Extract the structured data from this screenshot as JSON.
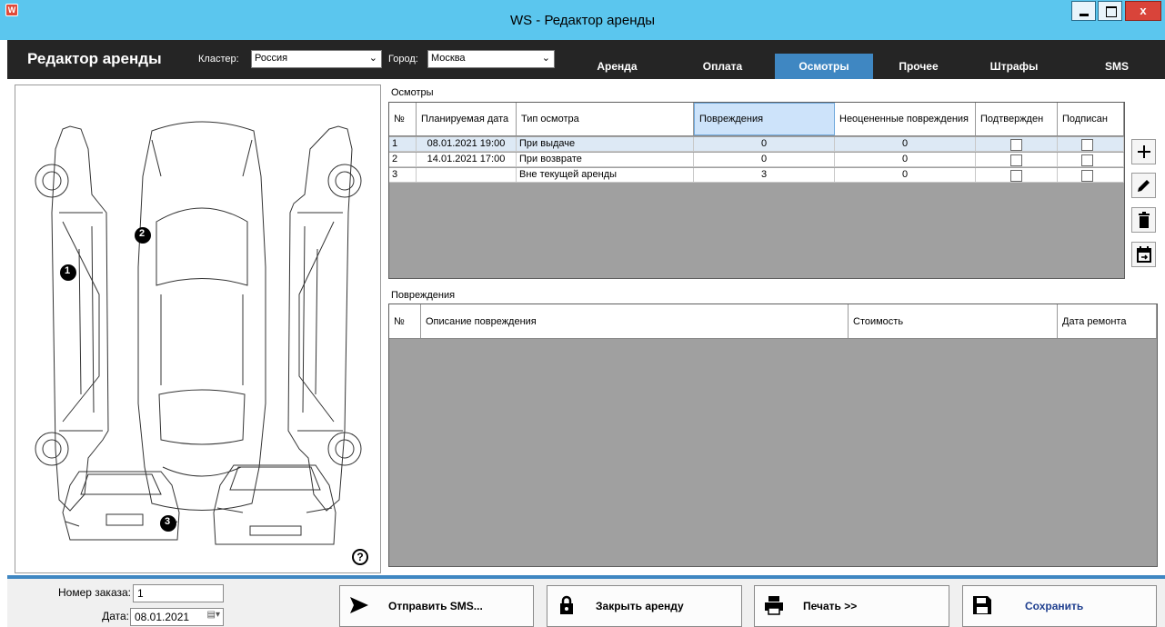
{
  "window": {
    "title": "WS - Редактор аренды",
    "icon_letter": "W"
  },
  "header": {
    "title": "Редактор аренды",
    "cluster_label": "Кластер:",
    "cluster_value": "Россия",
    "city_label": "Город:",
    "city_value": "Москва",
    "tabs": [
      {
        "label": "Аренда",
        "active": false
      },
      {
        "label": "Оплата",
        "active": false
      },
      {
        "label": "Осмотры",
        "active": true
      },
      {
        "label": "Прочее",
        "active": false
      },
      {
        "label": "Штрафы",
        "active": false
      },
      {
        "label": "SMS",
        "active": false
      }
    ]
  },
  "car_diagram": {
    "markers": [
      "1",
      "2",
      "3"
    ],
    "help_label": "?"
  },
  "inspections": {
    "group_title": "Осмотры",
    "columns": [
      "№",
      "Планируемая дата",
      "Тип осмотра",
      "Повреждения",
      "Неоцененные повреждения",
      "Подтвержден",
      "Подписан"
    ],
    "rows": [
      {
        "num": "1",
        "date": "08.01.2021 19:00",
        "type": "При выдаче",
        "damages": "0",
        "unrated": "0",
        "confirmed": false,
        "signed": false
      },
      {
        "num": "2",
        "date": "14.01.2021 17:00",
        "type": "При возврате",
        "damages": "0",
        "unrated": "0",
        "confirmed": false,
        "signed": false
      },
      {
        "num": "3",
        "date": "",
        "type": "Вне текущей аренды",
        "damages": "3",
        "unrated": "0",
        "confirmed": false,
        "signed": false
      }
    ],
    "side_actions": [
      "plus-icon",
      "pencil-icon",
      "trash-icon",
      "calendar-export-icon"
    ]
  },
  "damages": {
    "group_title": "Повреждения",
    "columns": [
      "№",
      "Описание повреждения",
      "Стоимость",
      "Дата ремонта"
    ]
  },
  "footer": {
    "order_label": "Номер заказа:",
    "order_value": "1",
    "date_label": "Дата:",
    "date_value": "08.01.2021",
    "buttons": {
      "send_sms": "Отправить SMS...",
      "close_rent": "Закрыть аренду",
      "print": "Печать  >>",
      "save": "Сохранить"
    }
  },
  "colors": {
    "titlebar": "#5bc6ee",
    "header": "#252525",
    "accent": "#3f87c2",
    "grid_empty": "#a0a0a0",
    "save_text": "#1f3f8f"
  }
}
